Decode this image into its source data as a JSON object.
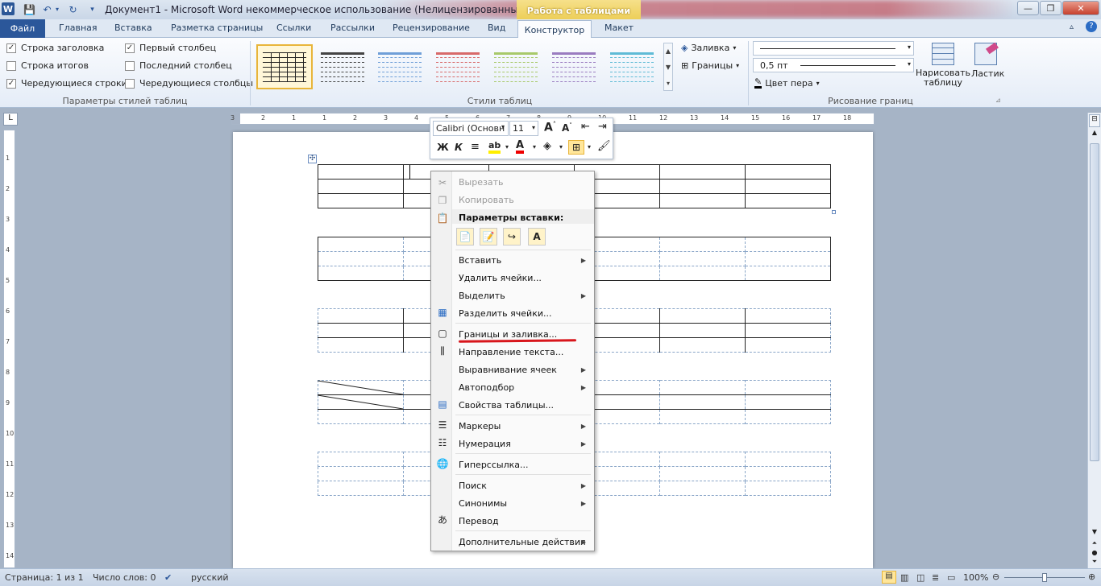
{
  "window": {
    "title": "Документ1 - Microsoft Word некоммерческое использование (Нелицензированный про...",
    "tools_tab": "Работа с таблицами",
    "controls": [
      "—",
      "❐",
      "✕"
    ]
  },
  "tabs": {
    "file": "Файл",
    "items": [
      "Главная",
      "Вставка",
      "Разметка страницы",
      "Ссылки",
      "Рассылки",
      "Рецензирование",
      "Вид"
    ],
    "active": "Конструктор",
    "layout": "Макет"
  },
  "ribbon": {
    "group_style_options": {
      "label": "Параметры стилей таблиц",
      "options": [
        {
          "label": "Строка заголовка",
          "checked": true
        },
        {
          "label": "Строка итогов",
          "checked": false
        },
        {
          "label": "Чередующиеся строки",
          "checked": true
        },
        {
          "label": "Первый столбец",
          "checked": true
        },
        {
          "label": "Последний столбец",
          "checked": false
        },
        {
          "label": "Чередующиеся столбцы",
          "checked": false
        }
      ]
    },
    "group_table_styles": {
      "label": "Стили таблиц",
      "fill": "Заливка",
      "borders": "Границы",
      "swatch_colors": [
        "#222222",
        "#444444",
        "#6f9fd8",
        "#d86a6a",
        "#a8c96a",
        "#9a7cc0",
        "#5fbbd6"
      ]
    },
    "group_draw_borders": {
      "label": "Рисование границ",
      "line_width": "0,5 пт",
      "pen_color": "Цвет пера",
      "draw_table": "Нарисовать таблицу",
      "eraser": "Ластик"
    }
  },
  "mini_toolbar": {
    "font": "Calibri (Основн",
    "size": "11",
    "bold": "Ж",
    "italic": "К"
  },
  "context_menu": {
    "cut": "Вырезать",
    "copy": "Копировать",
    "paste_options": "Параметры вставки:",
    "insert": "Вставить",
    "delete_cells": "Удалить ячейки...",
    "select": "Выделить",
    "split_cells": "Разделить ячейки...",
    "borders_shading": "Границы и заливка...",
    "text_direction": "Направление текста...",
    "cell_alignment": "Выравнивание ячеек",
    "autofit": "Автоподбор",
    "table_properties": "Свойства таблицы...",
    "bullets": "Маркеры",
    "numbering": "Нумерация",
    "hyperlink": "Гиперссылка...",
    "search": "Поиск",
    "synonyms": "Синонимы",
    "translate": "Перевод",
    "more_actions": "Дополнительные действия"
  },
  "status": {
    "page": "Страница: 1 из 1",
    "words": "Число слов: 0",
    "language": "русский",
    "zoom": "100%"
  },
  "ruler": {
    "h_ticks": [
      "3",
      "2",
      "1",
      "1",
      "2",
      "3",
      "4",
      "5",
      "6",
      "7",
      "8",
      "9",
      "10",
      "11",
      "12",
      "13",
      "14",
      "15",
      "16",
      "17",
      "18"
    ],
    "v_ticks": [
      "1",
      "2",
      "3",
      "4",
      "5",
      "6",
      "7",
      "8",
      "9",
      "10",
      "11",
      "12",
      "13",
      "14"
    ]
  }
}
